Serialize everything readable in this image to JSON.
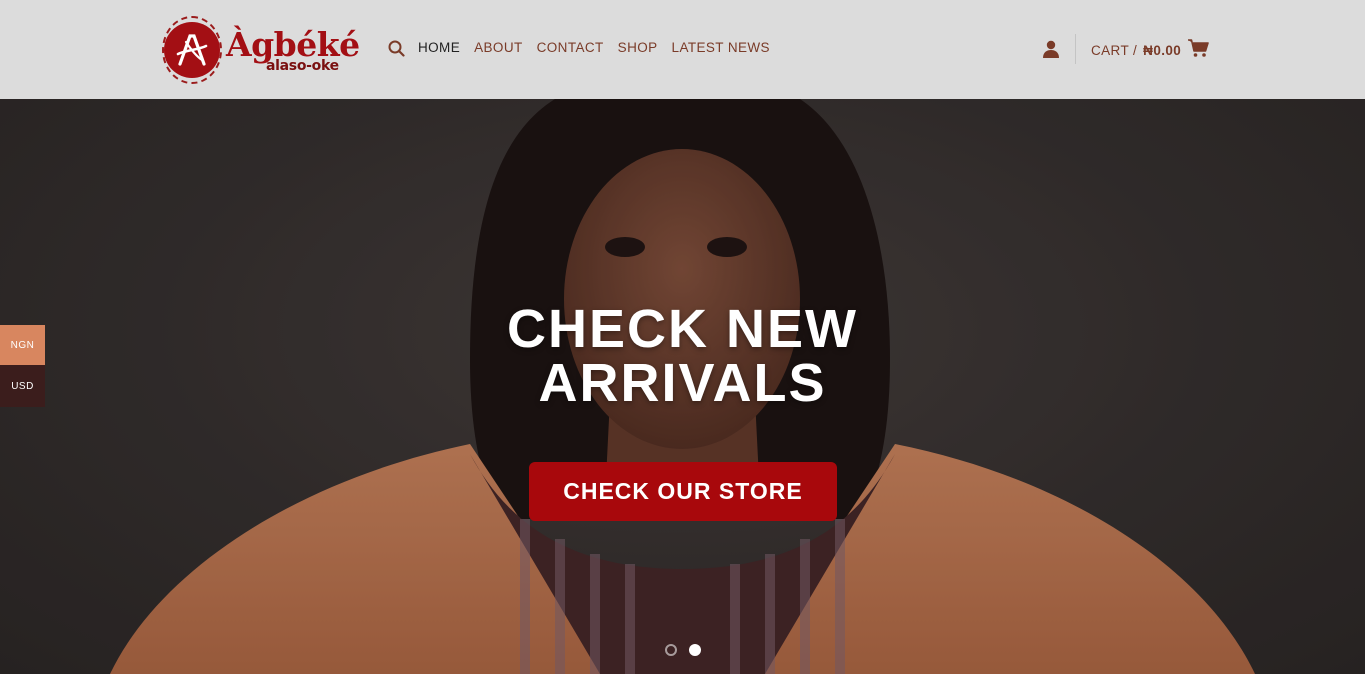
{
  "header": {
    "logo": {
      "name": "Àgbéké",
      "subtitle": "alaso-oke",
      "mark": "A"
    },
    "nav": [
      {
        "label": "HOME",
        "active": true
      },
      {
        "label": "ABOUT",
        "active": false
      },
      {
        "label": "CONTACT",
        "active": false
      },
      {
        "label": "SHOP",
        "active": false
      },
      {
        "label": "LATEST NEWS",
        "active": false
      }
    ],
    "cart": {
      "label": "CART /",
      "amount": "₦0.00"
    },
    "icons": {
      "search": "search-icon",
      "account": "user-icon",
      "cart": "cart-icon"
    }
  },
  "hero": {
    "title_line1": "CHECK NEW",
    "title_line2": "ARRIVALS",
    "cta_label": "CHECK OUR STORE",
    "slides": [
      {
        "active": false
      },
      {
        "active": true
      }
    ]
  },
  "currency": {
    "options": [
      "NGN",
      "USD"
    ]
  },
  "colors": {
    "brand_red": "#a30f14",
    "cta_red": "#a8080c",
    "nav_text": "#7a3b28",
    "header_bg": "#dcdcdc",
    "ngn_bg": "#d8865f",
    "usd_bg": "#3b1d1c"
  }
}
